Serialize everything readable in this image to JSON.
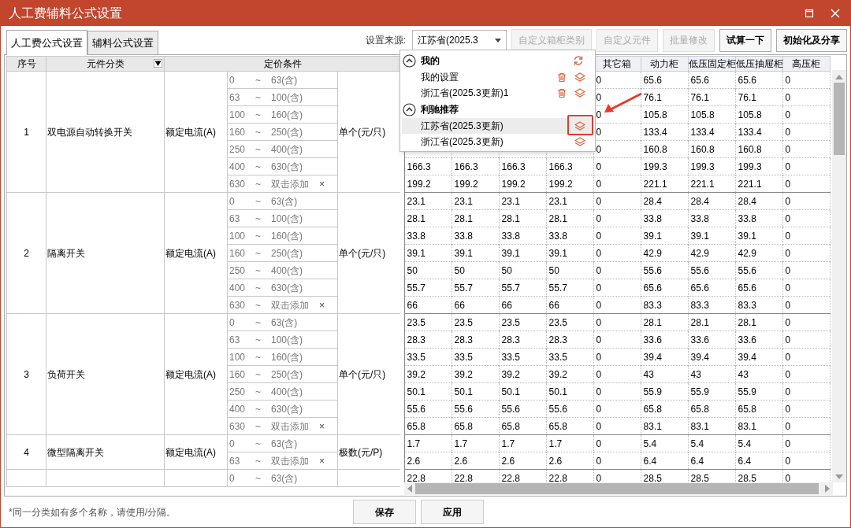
{
  "window": {
    "title": "人工费辅料公式设置"
  },
  "tabs": [
    {
      "label": "人工费公式设置",
      "selected": true
    },
    {
      "label": "辅料公式设置",
      "selected": false
    }
  ],
  "toolbar": {
    "source_label": "设置来源:",
    "source_value": "江苏省(2025.3",
    "buttons": [
      {
        "label": "自定义箱柜类别",
        "disabled": true
      },
      {
        "label": "自定义元件",
        "disabled": true
      },
      {
        "label": "批量修改",
        "disabled": true
      },
      {
        "label": "试算一下",
        "disabled": false
      },
      {
        "label": "初始化及分享",
        "disabled": false
      }
    ]
  },
  "pricing_table": {
    "columns": [
      "序号",
      "元件分类",
      "定价条件"
    ],
    "groups": [
      {
        "index": "1",
        "name": "双电源自动转换开关",
        "param": "额定电流(A)",
        "unit": "单个(元/只)",
        "ranges": [
          {
            "from": "0",
            "sep": "~",
            "to": "63(含)"
          },
          {
            "from": "63",
            "sep": "~",
            "to": "100(含)"
          },
          {
            "from": "100",
            "sep": "~",
            "to": "160(含)"
          },
          {
            "from": "160",
            "sep": "~",
            "to": "250(含)"
          },
          {
            "from": "250",
            "sep": "~",
            "to": "400(含)"
          },
          {
            "from": "400",
            "sep": "~",
            "to": "630(含)"
          },
          {
            "from": "630",
            "sep": "~",
            "to": "双击添加",
            "remove": "×"
          }
        ]
      },
      {
        "index": "2",
        "name": "隔离开关",
        "param": "额定电流(A)",
        "unit": "单个(元/只)",
        "ranges": [
          {
            "from": "0",
            "sep": "~",
            "to": "63(含)"
          },
          {
            "from": "63",
            "sep": "~",
            "to": "100(含)"
          },
          {
            "from": "100",
            "sep": "~",
            "to": "160(含)"
          },
          {
            "from": "160",
            "sep": "~",
            "to": "250(含)"
          },
          {
            "from": "250",
            "sep": "~",
            "to": "400(含)"
          },
          {
            "from": "400",
            "sep": "~",
            "to": "630(含)"
          },
          {
            "from": "630",
            "sep": "~",
            "to": "双击添加",
            "remove": "×"
          }
        ]
      },
      {
        "index": "3",
        "name": "负荷开关",
        "param": "额定电流(A)",
        "unit": "单个(元/只)",
        "ranges": [
          {
            "from": "0",
            "sep": "~",
            "to": "63(含)"
          },
          {
            "from": "63",
            "sep": "~",
            "to": "100(含)"
          },
          {
            "from": "100",
            "sep": "~",
            "to": "160(含)"
          },
          {
            "from": "160",
            "sep": "~",
            "to": "250(含)"
          },
          {
            "from": "250",
            "sep": "~",
            "to": "400(含)"
          },
          {
            "from": "400",
            "sep": "~",
            "to": "630(含)"
          },
          {
            "from": "630",
            "sep": "~",
            "to": "双击添加",
            "remove": "×"
          }
        ]
      },
      {
        "index": "4",
        "name": "微型隔离开关",
        "param": "额定电流(A)",
        "unit": "极数(元/P)",
        "ranges": [
          {
            "from": "0",
            "sep": "~",
            "to": "63(含)"
          },
          {
            "from": "63",
            "sep": "~",
            "to": "双击添加",
            "remove": "×"
          }
        ]
      },
      {
        "ranges": [
          {
            "from": "0",
            "sep": "~",
            "to": "63(含)"
          }
        ]
      }
    ]
  },
  "values_table": {
    "columns": [
      "其它箱",
      "动力柜",
      "低压固定柜",
      "低压抽屉柜",
      "高压柜"
    ],
    "groups": [
      [
        [
          "0",
          "65.6",
          "65.6",
          "65.6",
          "0"
        ],
        [
          "0",
          "76.1",
          "76.1",
          "76.1",
          "0"
        ],
        [
          "0",
          "105.8",
          "105.8",
          "105.8",
          "0"
        ],
        [
          "0",
          "133.4",
          "133.4",
          "133.4",
          "0"
        ],
        [
          "0",
          "160.8",
          "160.8",
          "160.8",
          "0"
        ],
        [
          "166.3",
          "166.3",
          "166.3",
          "166.3",
          "0",
          "199.3",
          "199.3",
          "199.3",
          "0"
        ],
        [
          "199.2",
          "199.2",
          "199.2",
          "199.2",
          "0",
          "221.1",
          "221.1",
          "221.1",
          "0"
        ]
      ],
      [
        [
          "23.1",
          "23.1",
          "23.1",
          "23.1",
          "0",
          "28.4",
          "28.4",
          "28.4",
          "0"
        ],
        [
          "28.1",
          "28.1",
          "28.1",
          "28.1",
          "0",
          "33.8",
          "33.8",
          "33.8",
          "0"
        ],
        [
          "33.8",
          "33.8",
          "33.8",
          "33.8",
          "0",
          "39.1",
          "39.1",
          "39.1",
          "0"
        ],
        [
          "39.1",
          "39.1",
          "39.1",
          "39.1",
          "0",
          "42.9",
          "42.9",
          "42.9",
          "0"
        ],
        [
          "50",
          "50",
          "50",
          "50",
          "0",
          "55.6",
          "55.6",
          "55.6",
          "0"
        ],
        [
          "55.7",
          "55.7",
          "55.7",
          "55.7",
          "0",
          "65.6",
          "65.6",
          "65.6",
          "0"
        ],
        [
          "66",
          "66",
          "66",
          "66",
          "0",
          "83.3",
          "83.3",
          "83.3",
          "0"
        ]
      ],
      [
        [
          "23.5",
          "23.5",
          "23.5",
          "23.5",
          "0",
          "28.1",
          "28.1",
          "28.1",
          "0"
        ],
        [
          "28.3",
          "28.3",
          "28.3",
          "28.3",
          "0",
          "33.6",
          "33.6",
          "33.6",
          "0"
        ],
        [
          "33.5",
          "33.5",
          "33.5",
          "33.5",
          "0",
          "39.4",
          "39.4",
          "39.4",
          "0"
        ],
        [
          "39.2",
          "39.2",
          "39.2",
          "39.2",
          "0",
          "43",
          "43",
          "43",
          "0"
        ],
        [
          "50.1",
          "50.1",
          "50.1",
          "50.1",
          "0",
          "55.9",
          "55.9",
          "55.9",
          "0"
        ],
        [
          "55.6",
          "55.6",
          "55.6",
          "55.6",
          "0",
          "65.8",
          "65.8",
          "65.8",
          "0"
        ],
        [
          "65.8",
          "65.8",
          "65.8",
          "65.8",
          "0",
          "83.1",
          "83.1",
          "83.1",
          "0"
        ]
      ],
      [
        [
          "1.7",
          "1.7",
          "1.7",
          "1.7",
          "0",
          "5.4",
          "5.4",
          "5.4",
          "0"
        ],
        [
          "2.6",
          "2.6",
          "2.6",
          "2.6",
          "0",
          "6.4",
          "6.4",
          "6.4",
          "0"
        ]
      ],
      [
        [
          "22.8",
          "22.8",
          "22.8",
          "22.8",
          "0",
          "28.5",
          "28.5",
          "28.5",
          "0"
        ]
      ]
    ]
  },
  "dropdown": {
    "sections": [
      {
        "title": "我的",
        "expanded": true,
        "refresh": true,
        "items": [
          {
            "label": "我的设置",
            "deletable": true,
            "selected": false
          },
          {
            "label": "浙江省(2025.3更新)1",
            "deletable": true,
            "selected": false
          }
        ]
      },
      {
        "title": "利驰推荐",
        "expanded": true,
        "refresh": false,
        "items": [
          {
            "label": "江苏省(2025.3更新)",
            "deletable": false,
            "selected": true
          },
          {
            "label": "浙江省(2025.3更新)",
            "deletable": false,
            "selected": false
          }
        ]
      }
    ]
  },
  "footer": {
    "note": "*同一分类如有多个名称，请使用/分隔。",
    "buttons": [
      "保存",
      "应用"
    ]
  }
}
